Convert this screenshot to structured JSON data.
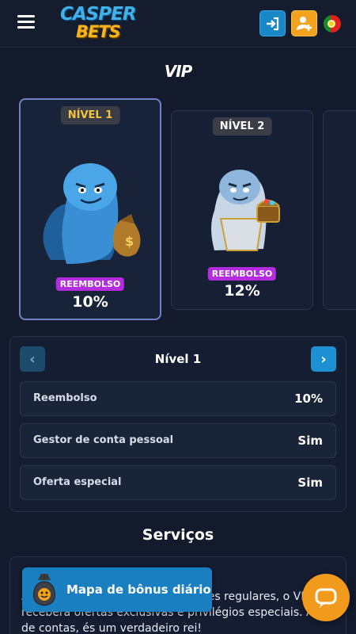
{
  "header": {
    "logo_line1": "CASPER",
    "logo_line2": "BETS",
    "icons": [
      "menu-icon",
      "login-icon",
      "register-icon",
      "portugal-flag-icon"
    ]
  },
  "page_title": "VIP",
  "levels": [
    {
      "badge": "NÍVEL 1",
      "cashback_label": "REEMBOLSO",
      "cashback": "10%"
    },
    {
      "badge": "NÍVEL 2",
      "cashback_label": "REEMBOLSO",
      "cashback": "12%"
    }
  ],
  "detail": {
    "title": "Nível 1",
    "rows": [
      {
        "label": "Reembolso",
        "value": "10%"
      },
      {
        "label": "Gestor de conta pessoal",
        "value": "Sim"
      },
      {
        "label": "Oferta especial",
        "value": "Sim"
      }
    ]
  },
  "services": {
    "title": "Serviços",
    "text": "Além das bonificações e promoções regulares, o VIP receberá ofertas exclusivas e privilégios especiais. Afinal de contas, és um verdadeiro rei!"
  },
  "bonus_map": {
    "label": "Mapa de bônus diário"
  },
  "colors": {
    "accent_blue": "#1d8fd3",
    "accent_orange": "#f29a1c",
    "cashback_purple": "#b52be0",
    "level1_gold": "#f3c33c"
  }
}
